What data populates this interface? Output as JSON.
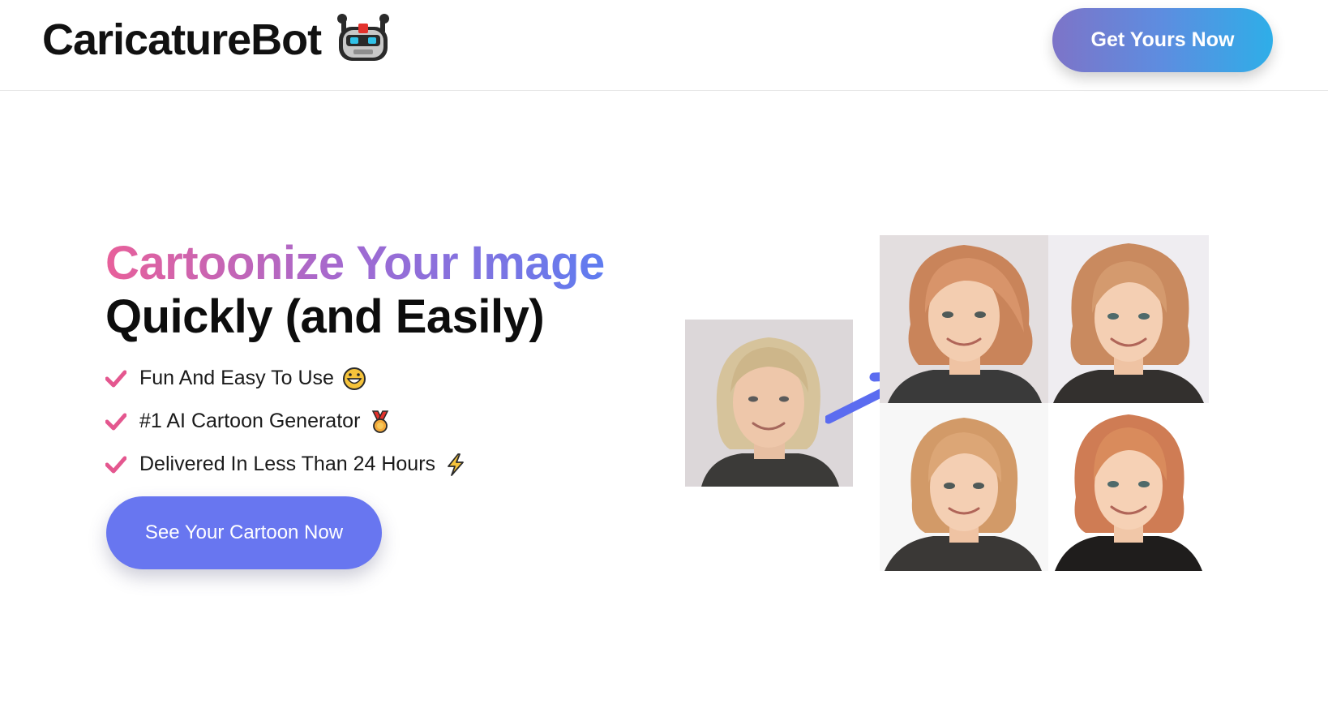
{
  "header": {
    "brand": "CaricatureBot",
    "brand_icon": "robot-icon",
    "cta_label": "Get Yours Now"
  },
  "hero": {
    "title_line1": "Cartoonize Your Image",
    "title_line2": "Quickly (and Easily)",
    "features": [
      {
        "text": "Fun And Easy To Use",
        "emoji": "grinning-face-icon"
      },
      {
        "text": "#1 AI Cartoon Generator",
        "emoji": "medal-icon"
      },
      {
        "text": "Delivered In Less Than 24 Hours",
        "emoji": "lightning-icon"
      }
    ],
    "cta_label": "See Your Cartoon Now"
  },
  "colors": {
    "gradient_pink": "#e8609a",
    "gradient_blue": "#5f7cf0",
    "check": "#e4578f",
    "cta_main": "#6876f0",
    "arrow": "#5b6cf0"
  },
  "gallery": {
    "original": "original-photo",
    "results": [
      "cartoon-result-1",
      "cartoon-result-2",
      "cartoon-result-3",
      "cartoon-result-4"
    ]
  }
}
